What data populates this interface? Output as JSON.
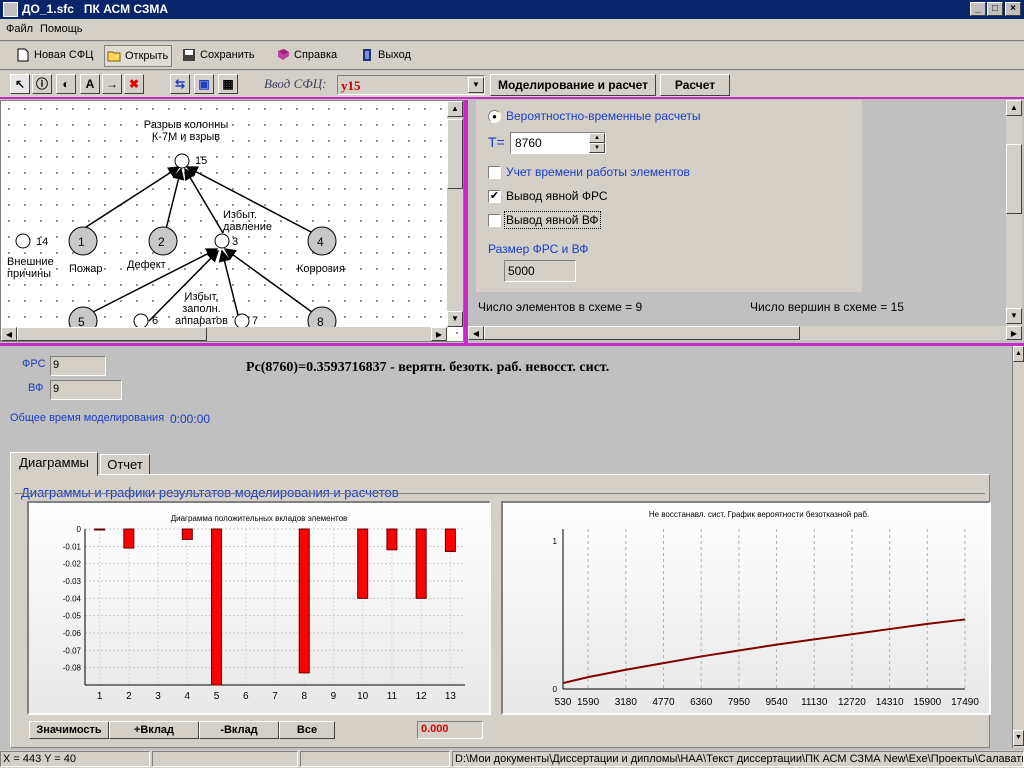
{
  "window": {
    "title": "ДО_1.sfc   ПК АСМ СЗМА",
    "min": "_",
    "max": "□",
    "close": "×"
  },
  "menu": [
    "Файл",
    "Помощь"
  ],
  "toolbar": {
    "new": "Новая СФЦ",
    "open": "Открыть",
    "save": "Сохранить",
    "help": "Справка",
    "exit": "Выход"
  },
  "toolbar2": {
    "tools": [
      "↖",
      "ⓘ",
      "◐",
      "A",
      "→",
      "✖",
      "⇆",
      "▣",
      "▦"
    ],
    "input_label": "Ввод СФЦ:",
    "input_value": "y15",
    "model_button": "Моделирование и расчет",
    "calc_button": "Расчет"
  },
  "diagram": {
    "top_label": "Разрыв колонны\nК-7М и взрыв",
    "top_num": "15",
    "nodes": [
      {
        "num": "1",
        "label": "Пожар"
      },
      {
        "num": "2",
        "label": "Дефект"
      },
      {
        "num": "4",
        "label": "Коррозия"
      },
      {
        "num": "5",
        "label": ""
      },
      {
        "num": "8",
        "label": ""
      }
    ],
    "node14": {
      "num": "14",
      "label": "Внешние\nпричины"
    },
    "node3": {
      "num": "3",
      "label": "Избыт.\nдавление"
    },
    "node6": "6",
    "node7": "7",
    "node_zapoln": "Избыт.\nзаполн.\nаппаратов"
  },
  "params": {
    "radio_label": "Вероятностно-временные расчеты",
    "t_label": "T=",
    "t_value": "8760",
    "cb1": "Учет времени работы элементов",
    "cb2": "Вывод явной ФРС",
    "cb3": "Вывод явной ВФ",
    "cb2_checked": "✔",
    "size_label": "Размер ФРС и ВФ",
    "size_value": "5000",
    "elements_count": "Число элементов в схеме = 9",
    "vertices_count": "Число вершин в схеме = 15"
  },
  "results": {
    "frs_label": "ФРС",
    "frs_value": "9",
    "vf_label": "ВФ",
    "vf_value": "9",
    "formula": "Pc(8760)=0.3593716837 - верятн. безотк. раб. невосст. сист.",
    "time_label": "Общее время моделирования",
    "time_value": "0:00:00"
  },
  "tabs": [
    "Диаграммы",
    "Отчет"
  ],
  "group_title": "Диаграммы и графики результатов моделирования и расчетов",
  "chart_data": [
    {
      "type": "bar",
      "title": "Диаграмма положительных вкладов элементов",
      "categories": [
        "1",
        "2",
        "4",
        "5",
        "8",
        "10",
        "11",
        "12",
        "13"
      ],
      "values": [
        -0.0005,
        -0.011,
        -0.006,
        -0.09,
        -0.083,
        -0.04,
        -0.012,
        -0.04,
        -0.013
      ],
      "ylim": [
        -0.09,
        0
      ],
      "yticks": [
        "0",
        "-0.01",
        "-0.02",
        "-0.03",
        "-0.04",
        "-0.05",
        "-0.06",
        "-0.07",
        "-0.08"
      ],
      "xticks": [
        "1",
        "2",
        "3",
        "4",
        "5",
        "6",
        "7",
        "8",
        "9",
        "10",
        "11",
        "12",
        "13"
      ],
      "grid": true,
      "color": "#ff0000"
    },
    {
      "type": "line",
      "title": "Не восстанавл. сист. График вероятности безотказной раб.",
      "x": [
        530,
        1590,
        3180,
        4770,
        6360,
        7950,
        9540,
        11130,
        12720,
        14310,
        15900,
        17490
      ],
      "y": [
        0.04,
        0.08,
        0.13,
        0.175,
        0.22,
        0.26,
        0.3,
        0.335,
        0.37,
        0.405,
        0.44,
        0.47
      ],
      "xticks": [
        "530",
        "1590",
        "3180",
        "4770",
        "6360",
        "7950",
        "9540",
        "11130",
        "12720",
        "14310",
        "15900",
        "17490"
      ],
      "yticks": [
        "1",
        "0"
      ],
      "ylim": [
        0,
        1
      ],
      "grid": true,
      "color": "#800000"
    }
  ],
  "buttons": {
    "significance": "Значимость",
    "plus": "+Вклад",
    "minus": "-Вклад",
    "all": "Все",
    "value": "0.000"
  },
  "status": {
    "coords": "X = 443 Y = 40",
    "path": "D:\\Мои документы\\Диссертации и дипломы\\НАА\\Текст диссертации\\ПК АСМ СЗМА New\\Exe\\Проекты\\Салаватг"
  }
}
